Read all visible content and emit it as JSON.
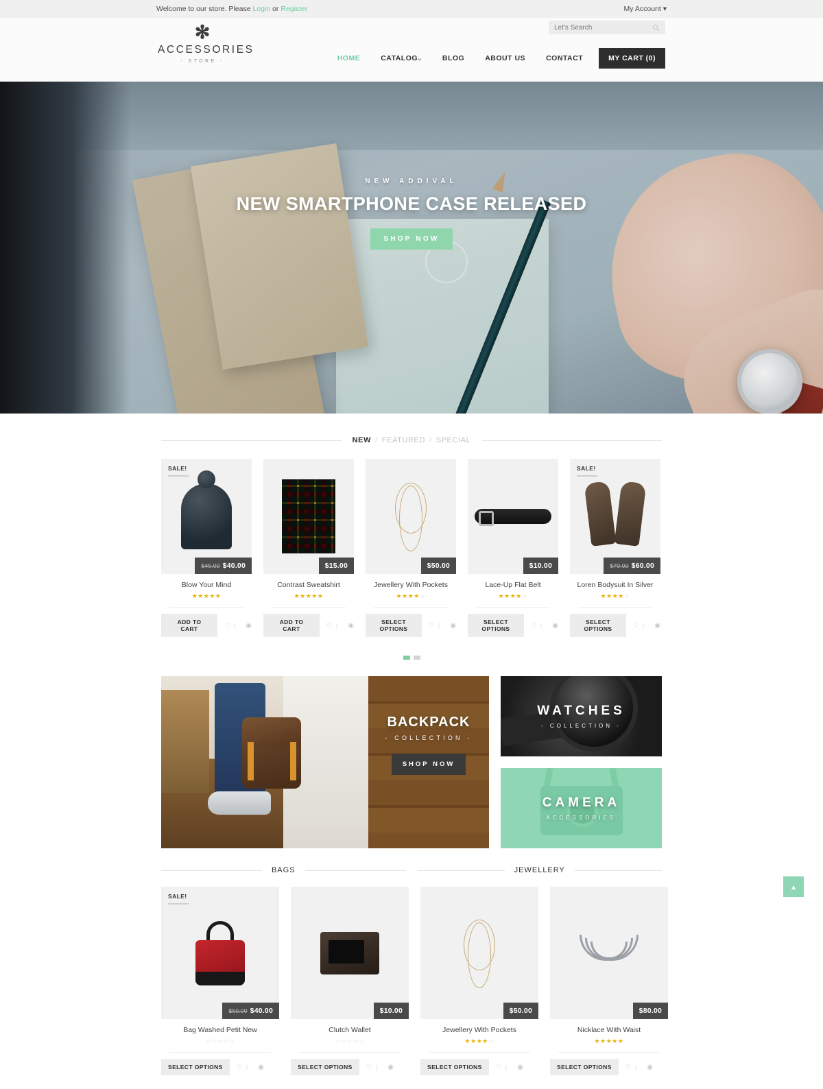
{
  "topbar": {
    "welcome_prefix": "Welcome to our store. Please",
    "login": "Login",
    "or": "or",
    "register": "Register",
    "account": "My Account",
    "caret": "▾"
  },
  "header": {
    "logo_mark": "✻",
    "logo_name": "ACCESSORIES",
    "logo_sub": "- STORE -",
    "search_placeholder": "Let's Search",
    "search_value": "",
    "nav": [
      {
        "label": "HOME",
        "active": true
      },
      {
        "label": "CATALOG",
        "active": false,
        "caret": "⌵"
      },
      {
        "label": "BLOG",
        "active": false
      },
      {
        "label": "ABOUT US",
        "active": false
      },
      {
        "label": "CONTACT",
        "active": false
      }
    ],
    "cart_label": "MY CART (0)"
  },
  "hero": {
    "kicker": "NEW ADDIVAL",
    "title": "NEW SMARTPHONE CASE RELEASED",
    "button": "SHOP NOW"
  },
  "tabs": {
    "items": [
      {
        "label": "NEW",
        "active": true
      },
      {
        "label": "FEATURED",
        "active": false
      },
      {
        "label": "SPECIAL",
        "active": false
      }
    ],
    "separator": "/"
  },
  "new_products": [
    {
      "name": "Blow Your Mind",
      "price": "$40.00",
      "old_price": "$45.00",
      "sale": "SALE!",
      "stars": 5,
      "action": "ADD TO CART",
      "art": "beanie"
    },
    {
      "name": "Contrast Sweatshirt",
      "price": "$15.00",
      "old_price": "",
      "sale": "",
      "stars": 5,
      "action": "ADD TO CART",
      "art": "scarf"
    },
    {
      "name": "Jewellery With Pockets",
      "price": "$50.00",
      "old_price": "",
      "sale": "",
      "stars": 4,
      "action": "SELECT OPTIONS",
      "art": "neck"
    },
    {
      "name": "Lace-Up Flat Belt",
      "price": "$10.00",
      "old_price": "",
      "sale": "",
      "stars": 4,
      "action": "SELECT OPTIONS",
      "art": "belt"
    },
    {
      "name": "Loren Bodysuit In Silver",
      "price": "$60.00",
      "old_price": "$70.00",
      "sale": "SALE!",
      "stars": 4,
      "action": "SELECT OPTIONS",
      "art": "gloves"
    }
  ],
  "carousel": {
    "dots": 2,
    "active_dot": 0
  },
  "banners": {
    "backpack": {
      "title": "BACKPACK",
      "subtitle": "- COLLECTION -",
      "button": "SHOP NOW"
    },
    "watches": {
      "title": "WATCHES",
      "subtitle": "- COLLECTION -"
    },
    "camera": {
      "title": "CAMERA",
      "subtitle": "- ACCESSORIES -"
    }
  },
  "sections": [
    {
      "title": "BAGS"
    },
    {
      "title": "JEWELLERY"
    }
  ],
  "bags_products": [
    {
      "name": "Bag Washed Petit New",
      "price": "$40.00",
      "old_price": "$50.00",
      "sale": "SALE!",
      "stars": 0,
      "action": "SELECT OPTIONS",
      "art": "bag"
    },
    {
      "name": "Clutch Wallet",
      "price": "$10.00",
      "old_price": "",
      "sale": "",
      "stars": 0,
      "action": "SELECT OPTIONS",
      "art": "wallet"
    }
  ],
  "jewellery_products": [
    {
      "name": "Jewellery With Pockets",
      "price": "$50.00",
      "old_price": "",
      "sale": "",
      "stars": 4,
      "action": "SELECT OPTIONS",
      "art": "neck2"
    },
    {
      "name": "Nicklace With Waist",
      "price": "$80.00",
      "old_price": "",
      "sale": "",
      "stars": 5,
      "action": "SELECT OPTIONS",
      "art": "necklace2"
    }
  ],
  "icons": {
    "wishlist": "♡",
    "compare": "◉",
    "divider": "|",
    "scroll_top": "▴",
    "search": "⌕"
  },
  "colors": {
    "accent": "#8fd6b4",
    "dark": "#2e2e2e",
    "price_bg": "#4a4a4a",
    "star": "#e8b30c"
  }
}
